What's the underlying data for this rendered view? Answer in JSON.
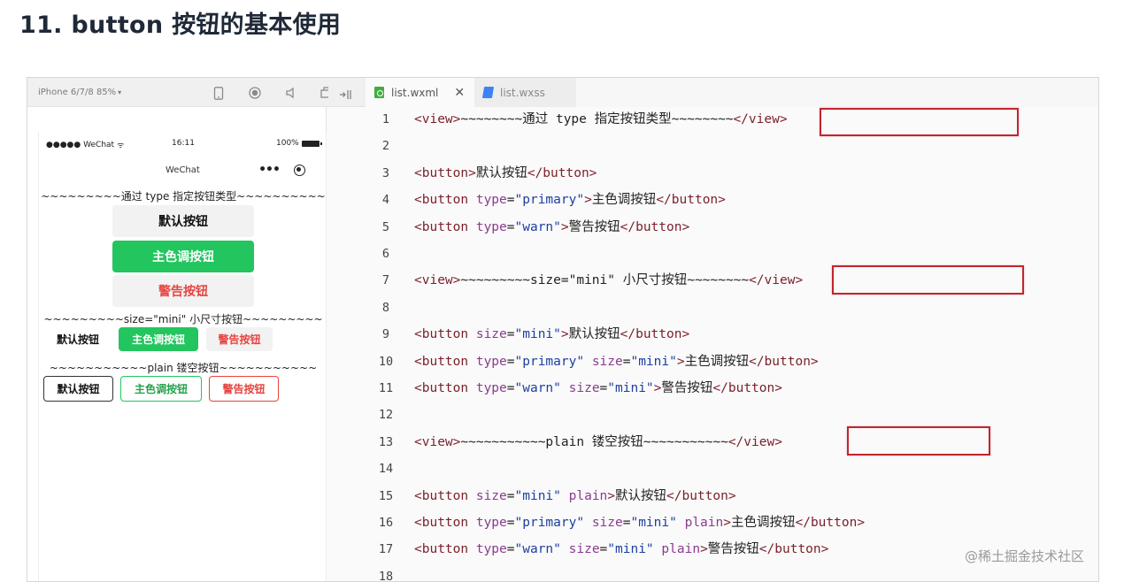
{
  "heading": "11. button 按钮的基本使用",
  "simulator": {
    "device": "iPhone 6/7/8 85%",
    "tools": [
      "phone-icon",
      "record-icon",
      "volume-icon",
      "window-icon"
    ],
    "status": {
      "carrier": "●●●●● WeChat",
      "time": "16:11",
      "battery": "100%"
    },
    "nav_title": "WeChat",
    "capsule_more": "•••",
    "lines": {
      "type": "~~~~~~~~~通过 type 指定按钮类型~~~~~~~~~~",
      "size": "~~~~~~~~~size=\"mini\" 小尺寸按钮~~~~~~~~~",
      "plain": "~~~~~~~~~~~plain 镂空按钮~~~~~~~~~~~"
    },
    "buttons": {
      "default": "默认按钮",
      "primary": "主色调按钮",
      "warn": "警告按钮"
    }
  },
  "editor": {
    "tabs": [
      {
        "label": "list.wxml",
        "close": "✕"
      },
      {
        "label": "list.wxss"
      }
    ],
    "lines": [
      {
        "n": "1",
        "tokens": [
          [
            "t",
            "<view>"
          ],
          [
            "x",
            "~~~~~~~~通过 type 指定按钮类型~~~~~~~~"
          ],
          [
            "t",
            "</view>"
          ]
        ]
      },
      {
        "n": "2",
        "tokens": []
      },
      {
        "n": "3",
        "tokens": [
          [
            "t",
            "<button>"
          ],
          [
            "x",
            "默认按钮"
          ],
          [
            "t",
            "</button>"
          ]
        ]
      },
      {
        "n": "4",
        "tokens": [
          [
            "t",
            "<button "
          ],
          [
            "a",
            "type"
          ],
          [
            "x",
            "="
          ],
          [
            "s",
            "\"primary\""
          ],
          [
            "t",
            ">"
          ],
          [
            "x",
            "主色调按钮"
          ],
          [
            "t",
            "</button>"
          ]
        ]
      },
      {
        "n": "5",
        "tokens": [
          [
            "t",
            "<button "
          ],
          [
            "a",
            "type"
          ],
          [
            "x",
            "="
          ],
          [
            "s",
            "\"warn\""
          ],
          [
            "t",
            ">"
          ],
          [
            "x",
            "警告按钮"
          ],
          [
            "t",
            "</button>"
          ]
        ]
      },
      {
        "n": "6",
        "tokens": []
      },
      {
        "n": "7",
        "tokens": [
          [
            "t",
            "<view>"
          ],
          [
            "x",
            "~~~~~~~~~size=\"mini\" 小尺寸按钮~~~~~~~~"
          ],
          [
            "t",
            "</view>"
          ]
        ]
      },
      {
        "n": "8",
        "tokens": []
      },
      {
        "n": "9",
        "tokens": [
          [
            "t",
            "<button "
          ],
          [
            "a",
            "size"
          ],
          [
            "x",
            "="
          ],
          [
            "s",
            "\"mini\""
          ],
          [
            "t",
            ">"
          ],
          [
            "x",
            "默认按钮"
          ],
          [
            "t",
            "</button>"
          ]
        ]
      },
      {
        "n": "10",
        "tokens": [
          [
            "t",
            "<button "
          ],
          [
            "a",
            "type"
          ],
          [
            "x",
            "="
          ],
          [
            "s",
            "\"primary\""
          ],
          [
            "x",
            " "
          ],
          [
            "a",
            "size"
          ],
          [
            "x",
            "="
          ],
          [
            "s",
            "\"mini\""
          ],
          [
            "t",
            ">"
          ],
          [
            "x",
            "主色调按钮"
          ],
          [
            "t",
            "</button>"
          ]
        ]
      },
      {
        "n": "11",
        "tokens": [
          [
            "t",
            "<button "
          ],
          [
            "a",
            "type"
          ],
          [
            "x",
            "="
          ],
          [
            "s",
            "\"warn\""
          ],
          [
            "x",
            " "
          ],
          [
            "a",
            "size"
          ],
          [
            "x",
            "="
          ],
          [
            "s",
            "\"mini\""
          ],
          [
            "t",
            ">"
          ],
          [
            "x",
            "警告按钮"
          ],
          [
            "t",
            "</button>"
          ]
        ]
      },
      {
        "n": "12",
        "tokens": []
      },
      {
        "n": "13",
        "tokens": [
          [
            "t",
            "<view>"
          ],
          [
            "x",
            "~~~~~~~~~~~plain 镂空按钮~~~~~~~~~~~"
          ],
          [
            "t",
            "</view>"
          ]
        ]
      },
      {
        "n": "14",
        "tokens": []
      },
      {
        "n": "15",
        "tokens": [
          [
            "t",
            "<button "
          ],
          [
            "a",
            "size"
          ],
          [
            "x",
            "="
          ],
          [
            "s",
            "\"mini\""
          ],
          [
            "x",
            " "
          ],
          [
            "a",
            "plain"
          ],
          [
            "t",
            ">"
          ],
          [
            "x",
            "默认按钮"
          ],
          [
            "t",
            "</button>"
          ]
        ]
      },
      {
        "n": "16",
        "tokens": [
          [
            "t",
            "<button "
          ],
          [
            "a",
            "type"
          ],
          [
            "x",
            "="
          ],
          [
            "s",
            "\"primary\""
          ],
          [
            "x",
            " "
          ],
          [
            "a",
            "size"
          ],
          [
            "x",
            "="
          ],
          [
            "s",
            "\"mini\""
          ],
          [
            "x",
            " "
          ],
          [
            "a",
            "plain"
          ],
          [
            "t",
            ">"
          ],
          [
            "x",
            "主色调按钮"
          ],
          [
            "t",
            "</button>"
          ]
        ]
      },
      {
        "n": "17",
        "tokens": [
          [
            "t",
            "<button "
          ],
          [
            "a",
            "type"
          ],
          [
            "x",
            "="
          ],
          [
            "s",
            "\"warn\""
          ],
          [
            "x",
            " "
          ],
          [
            "a",
            "size"
          ],
          [
            "x",
            "="
          ],
          [
            "s",
            "\"mini\""
          ],
          [
            "x",
            " "
          ],
          [
            "a",
            "plain"
          ],
          [
            "t",
            ">"
          ],
          [
            "x",
            "警告按钮"
          ],
          [
            "t",
            "</button>"
          ]
        ]
      },
      {
        "n": "18",
        "tokens": []
      }
    ],
    "colors": {
      "tag": "#7b1f29",
      "attribute": "#8a3b8f",
      "string": "#1b3fa0",
      "highlight": "#c3252e"
    }
  },
  "watermark": "@稀土掘金技术社区"
}
